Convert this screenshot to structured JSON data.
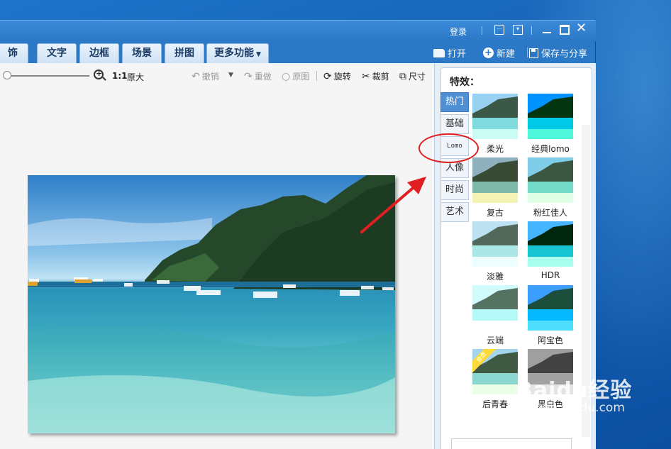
{
  "titlebar": {
    "login": "登录"
  },
  "tabs": [
    "饰品",
    "文字",
    "边框",
    "场景",
    "拼图"
  ],
  "more_tab": "更多功能",
  "actions": {
    "open": "打开",
    "new": "新建",
    "save_share": "保存与分享"
  },
  "toolbar": {
    "ratio": "1:1",
    "original_size": "原大",
    "undo": "撤销",
    "redo": "重做",
    "reset": "原图",
    "rotate": "旋转",
    "crop": "裁剪",
    "resize": "尺寸"
  },
  "effects": {
    "title": "特效：",
    "categories": [
      "热门",
      "基础",
      "Lomo",
      "人像",
      "时尚",
      "艺术"
    ],
    "active_category": "热门",
    "items": [
      "柔光",
      "经典lomo",
      "复古",
      "粉红佳人",
      "淡雅",
      "HDR",
      "云端",
      "阿宝色",
      "后青春",
      "黑白色"
    ],
    "vip_badge": "会员"
  },
  "watermark": {
    "logo": "Baidu经验",
    "url": "jingyan.baidu.com"
  },
  "colors": {
    "window_blue": "#2b78c7",
    "tab_text": "#1b3b66",
    "active_category": "#4f8fd3",
    "annotation_red": "#e02020"
  }
}
